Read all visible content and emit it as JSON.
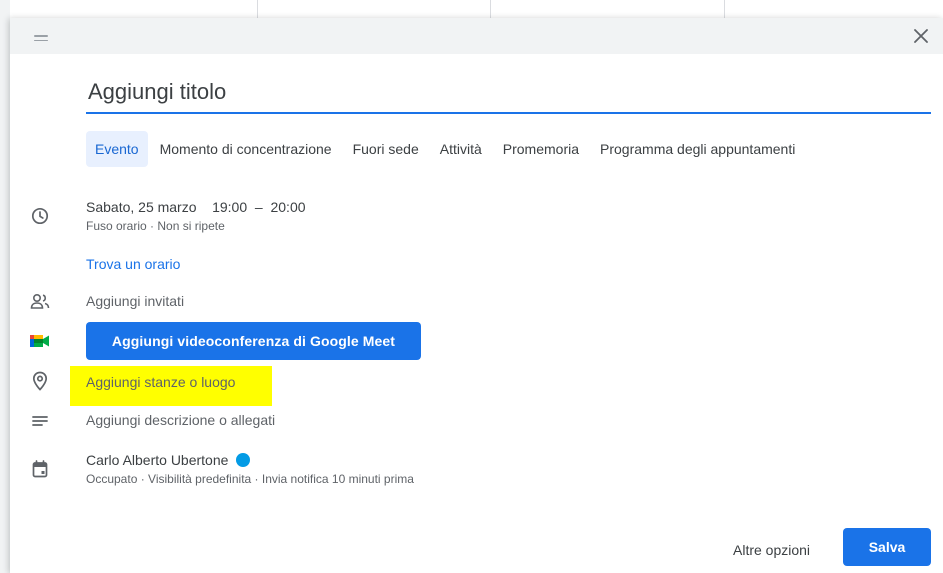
{
  "title": {
    "placeholder": "Aggiungi titolo"
  },
  "tabs": [
    {
      "label": "Evento",
      "active": true
    },
    {
      "label": "Momento di concentrazione"
    },
    {
      "label": "Fuori sede"
    },
    {
      "label": "Attività"
    },
    {
      "label": "Promemoria"
    },
    {
      "label": "Programma degli appuntamenti"
    }
  ],
  "datetime": {
    "date": "Sabato, 25 marzo",
    "start": "19:00",
    "separator": "–",
    "end": "20:00",
    "timezone": "Fuso orario",
    "dot": "·",
    "repeat": "Non si ripete"
  },
  "find_time": "Trova un orario",
  "guests": "Aggiungi invitati",
  "meet_button": "Aggiungi videoconferenza di Google Meet",
  "location": "Aggiungi stanze o luogo",
  "description": "Aggiungi descrizione o allegati",
  "calendar": {
    "owner": "Carlo Alberto Ubertone",
    "color": "#039be5",
    "details": "Occupato · Visibilità predefinita · Invia notifica 10 minuti prima"
  },
  "footer": {
    "more_options": "Altre opzioni",
    "save": "Salva"
  },
  "icons": {
    "drag": "drag-handle-icon",
    "close": "close-icon",
    "time": "clock-icon",
    "guests": "people-icon",
    "meet": "google-meet-icon",
    "location": "location-pin-icon",
    "description": "notes-icon",
    "calendar": "calendar-icon"
  },
  "colors": {
    "accent": "#1a73e8",
    "highlight": "#ffff00"
  }
}
